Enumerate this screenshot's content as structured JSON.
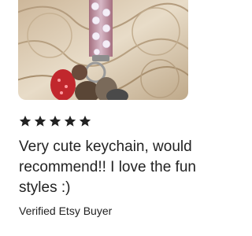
{
  "review": {
    "photo_alt": "",
    "rating": 5,
    "stars": [
      "star-filled",
      "star-filled",
      "star-filled",
      "star-filled",
      "star-filled"
    ],
    "text": "Very cute keychain, would recommend!! I love the fun styles :)",
    "reviewer": "Verified Etsy Buyer"
  },
  "colors": {
    "text": "#222222",
    "star": "#222222",
    "background": "#ffffff"
  }
}
